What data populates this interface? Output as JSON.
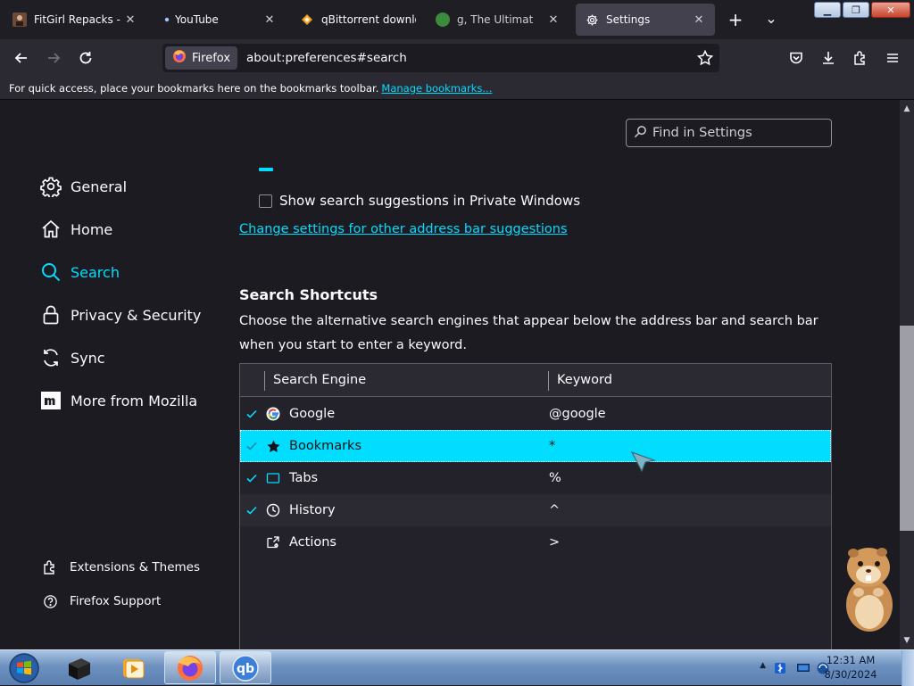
{
  "browser": {
    "tabs": [
      {
        "label": "FitGirl Repacks - Th",
        "icon": "fitgirl-favicon",
        "active": false
      },
      {
        "label": "YouTube",
        "icon": "dot-favicon",
        "active": false
      },
      {
        "label": "qBittorrent downlo",
        "icon": "diamond-favicon",
        "active": false
      },
      {
        "label": "g, The Ultimat",
        "icon": "media-favicon",
        "active": false
      },
      {
        "label": "Settings",
        "icon": "gear-icon",
        "active": true
      }
    ],
    "new_tab_glyph": "+",
    "list_tabs_glyph": "⌄",
    "identity_label": "Firefox",
    "url": "about:preferences#search",
    "bookmarks_bar_message": "For quick access, place your bookmarks here on the bookmarks toolbar.",
    "manage_bookmarks_link": "Manage bookmarks..."
  },
  "settings": {
    "find_placeholder": "Find in Settings",
    "categories": [
      {
        "label": "General",
        "icon": "gear-icon"
      },
      {
        "label": "Home",
        "icon": "home-icon"
      },
      {
        "label": "Search",
        "icon": "search-icon",
        "selected": true
      },
      {
        "label": "Privacy & Security",
        "icon": "lock-icon"
      },
      {
        "label": "Sync",
        "icon": "sync-icon"
      },
      {
        "label": "More from Mozilla",
        "icon": "mozilla-m-icon"
      }
    ],
    "footer_links": [
      {
        "label": "Extensions & Themes",
        "icon": "puzzle-icon"
      },
      {
        "label": "Firefox Support",
        "icon": "help-icon"
      }
    ],
    "private_suggestions_label": "Show search suggestions in Private Windows",
    "private_suggestions_checked": false,
    "change_settings_link": "Change settings for other address bar suggestions",
    "shortcuts": {
      "title": "Search Shortcuts",
      "description": "Choose the alternative search engines that appear below the address bar and search bar when you start to enter a keyword.",
      "columns": [
        "Search Engine",
        "Keyword"
      ],
      "rows": [
        {
          "name": "Google",
          "keyword": "@google",
          "checked": true,
          "icon": "google-g-icon"
        },
        {
          "name": "Bookmarks",
          "keyword": "*",
          "checked": true,
          "icon": "star-icon",
          "selected": true
        },
        {
          "name": "Tabs",
          "keyword": "%",
          "checked": true,
          "icon": "tab-icon"
        },
        {
          "name": "History",
          "keyword": "^",
          "checked": true,
          "icon": "clock-icon"
        },
        {
          "name": "Actions",
          "keyword": ">",
          "checked": false,
          "icon": "actions-icon"
        }
      ]
    }
  },
  "taskbar": {
    "time": "12:31 AM",
    "date": "8/30/2024",
    "pinned": [
      "windows-start-orb",
      "cube-app-icon",
      "media-player-icon",
      "firefox-icon",
      "qbittorrent-icon"
    ],
    "qb_label": "qb"
  },
  "colors": {
    "accent": "#00ddff",
    "background": "#1c1b22",
    "toolbar": "#2b2a33"
  }
}
